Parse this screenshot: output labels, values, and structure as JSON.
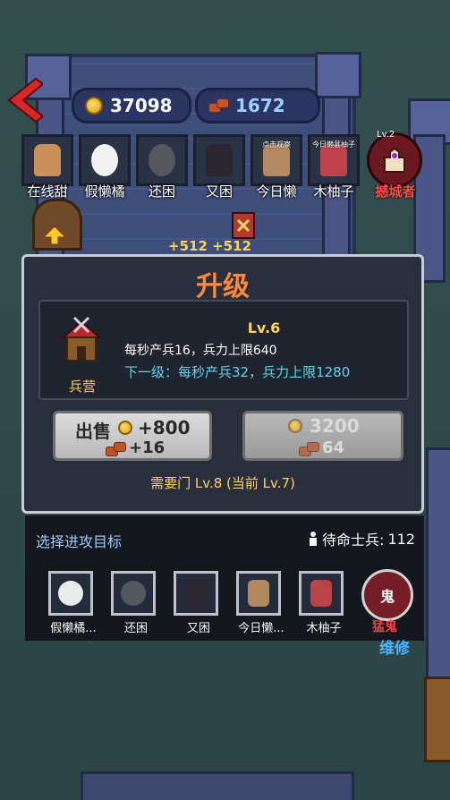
{
  "resources": {
    "gold": "37098",
    "wood": "1672"
  },
  "friends": [
    {
      "name": "在线甜",
      "tag": ""
    },
    {
      "name": "假懒橘",
      "tag": ""
    },
    {
      "name": "还困",
      "tag": ""
    },
    {
      "name": "又困",
      "tag": ""
    },
    {
      "name": "今日懒",
      "tag": "点击观察"
    },
    {
      "name": "木柚子",
      "tag": "今日懒葚柚子"
    }
  ],
  "enemy": {
    "level": "Lv.2",
    "name": "撼城者"
  },
  "map_text": "+512 +512",
  "upgrade": {
    "title": "升级",
    "building": "兵营",
    "level": "Lv.6",
    "current": "每秒产兵16，兵力上限640",
    "next": "下一级：每秒产兵32，兵力上限1280",
    "sell_label": "出售",
    "sell_gold": "+800",
    "sell_wood": "+16",
    "upgrade_gold": "3200",
    "upgrade_wood": "64",
    "requirement": "需要门 Lv.8 (当前 Lv.7)"
  },
  "attack": {
    "title": "选择进攻目标",
    "soldiers_label": "待命士兵:",
    "soldiers": "112",
    "targets": [
      "假懒橘...",
      "还困",
      "又困",
      "今日懒...",
      "木柚子"
    ],
    "boss_icon": "鬼",
    "boss_name": "猛鬼"
  },
  "maintenance": "维修",
  "colors": {
    "title": "#ff8a3c",
    "next_level": "#5fd6ec",
    "gold_text": "#ffd25a",
    "enemy": "#ff4848"
  }
}
